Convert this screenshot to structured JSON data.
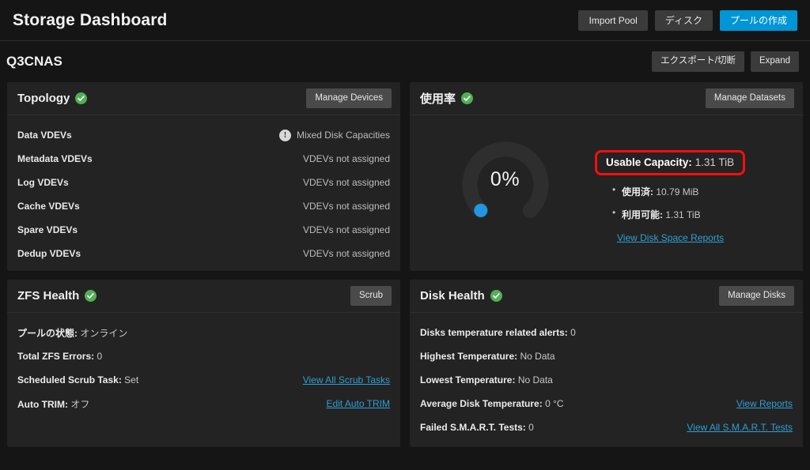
{
  "header": {
    "title": "Storage Dashboard",
    "buttons": [
      {
        "label": "Import Pool",
        "style": "dim"
      },
      {
        "label": "ディスク",
        "style": "dim"
      },
      {
        "label": "プールの作成",
        "style": "primary"
      }
    ]
  },
  "pool": {
    "name": "Q3CNAS",
    "buttons": [
      {
        "label": "エクスポート/切断"
      },
      {
        "label": "Expand"
      }
    ]
  },
  "topology": {
    "title": "Topology",
    "status_icon": "check-circle-icon",
    "action_label": "Manage Devices",
    "rows": [
      {
        "key": "Data VDEVs",
        "value": "Mixed Disk Capacities",
        "warning": true
      },
      {
        "key": "Metadata VDEVs",
        "value": "VDEVs not assigned",
        "warning": false
      },
      {
        "key": "Log VDEVs",
        "value": "VDEVs not assigned",
        "warning": false
      },
      {
        "key": "Cache VDEVs",
        "value": "VDEVs not assigned",
        "warning": false
      },
      {
        "key": "Spare VDEVs",
        "value": "VDEVs not assigned",
        "warning": false
      },
      {
        "key": "Dedup VDEVs",
        "value": "VDEVs not assigned",
        "warning": false
      }
    ]
  },
  "usage": {
    "title": "使用率",
    "status_icon": "check-circle-icon",
    "action_label": "Manage Datasets",
    "gauge_percent": "0%",
    "gauge_value": 0,
    "capacity_label": "Usable Capacity:",
    "capacity_value": "1.31 TiB",
    "highlight_color": "#fd0d0d",
    "items": [
      {
        "label": "使用済:",
        "value": "10.79 MiB"
      },
      {
        "label": "利用可能:",
        "value": "1.31 TiB"
      }
    ],
    "link_label": "View Disk Space Reports"
  },
  "zfs_health": {
    "title": "ZFS Health",
    "status_icon": "check-circle-icon",
    "action_label": "Scrub",
    "rows": [
      {
        "label": "プールの状態:",
        "value": "オンライン",
        "link": ""
      },
      {
        "label": "Total ZFS Errors:",
        "value": "0",
        "link": ""
      },
      {
        "label": "Scheduled Scrub Task:",
        "value": "Set",
        "link": "View All Scrub Tasks"
      },
      {
        "label": "Auto TRIM:",
        "value": "オフ",
        "link": "Edit Auto TRIM"
      }
    ]
  },
  "disk_health": {
    "title": "Disk Health",
    "status_icon": "check-circle-icon",
    "action_label": "Manage Disks",
    "rows": [
      {
        "label": "Disks temperature related alerts:",
        "value": "0",
        "link": ""
      },
      {
        "label": "Highest Temperature:",
        "value": "No Data",
        "link": ""
      },
      {
        "label": "Lowest Temperature:",
        "value": "No Data",
        "link": ""
      },
      {
        "label": "Average Disk Temperature:",
        "value": "0 °C",
        "link": "View Reports"
      },
      {
        "label": "Failed S.M.A.R.T. Tests:",
        "value": "0",
        "link": "View All S.M.A.R.T. Tests"
      }
    ]
  },
  "colors": {
    "page_background": "#151515",
    "card_background": "#232323",
    "accent_blue": "#0095d5",
    "status_green": "#52b054",
    "link_blue": "#2e9fd4",
    "highlight_red": "#fd0d0d"
  }
}
